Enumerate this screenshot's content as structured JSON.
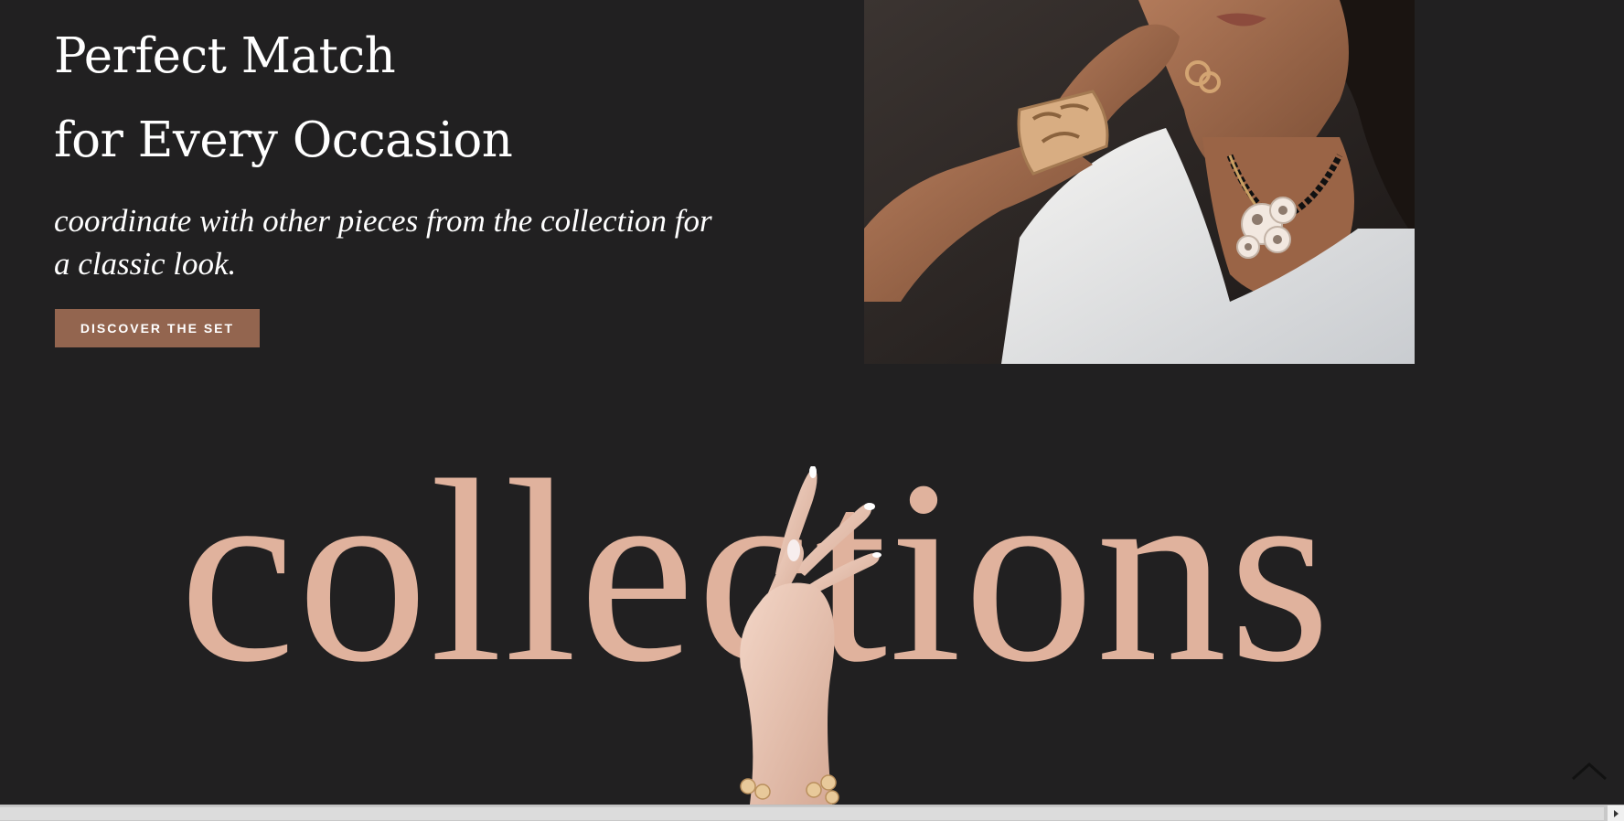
{
  "hero": {
    "title_line1": "Perfect Match",
    "title_line2": "for Every Occasion",
    "subtitle": "coordinate with other pieces from the collection for a classic look.",
    "cta_label": "DISCOVER THE SET",
    "image_alt": "Model wearing gold cuff bracelet, ring earrings and pendant necklace"
  },
  "collections": {
    "heading": "collections"
  },
  "icons": {
    "scroll_top": "chevron-up-icon",
    "scroll_right": "arrow-right-icon"
  },
  "colors": {
    "background": "#212021",
    "accent": "#93654f",
    "collections_text": "#e0b29d"
  }
}
